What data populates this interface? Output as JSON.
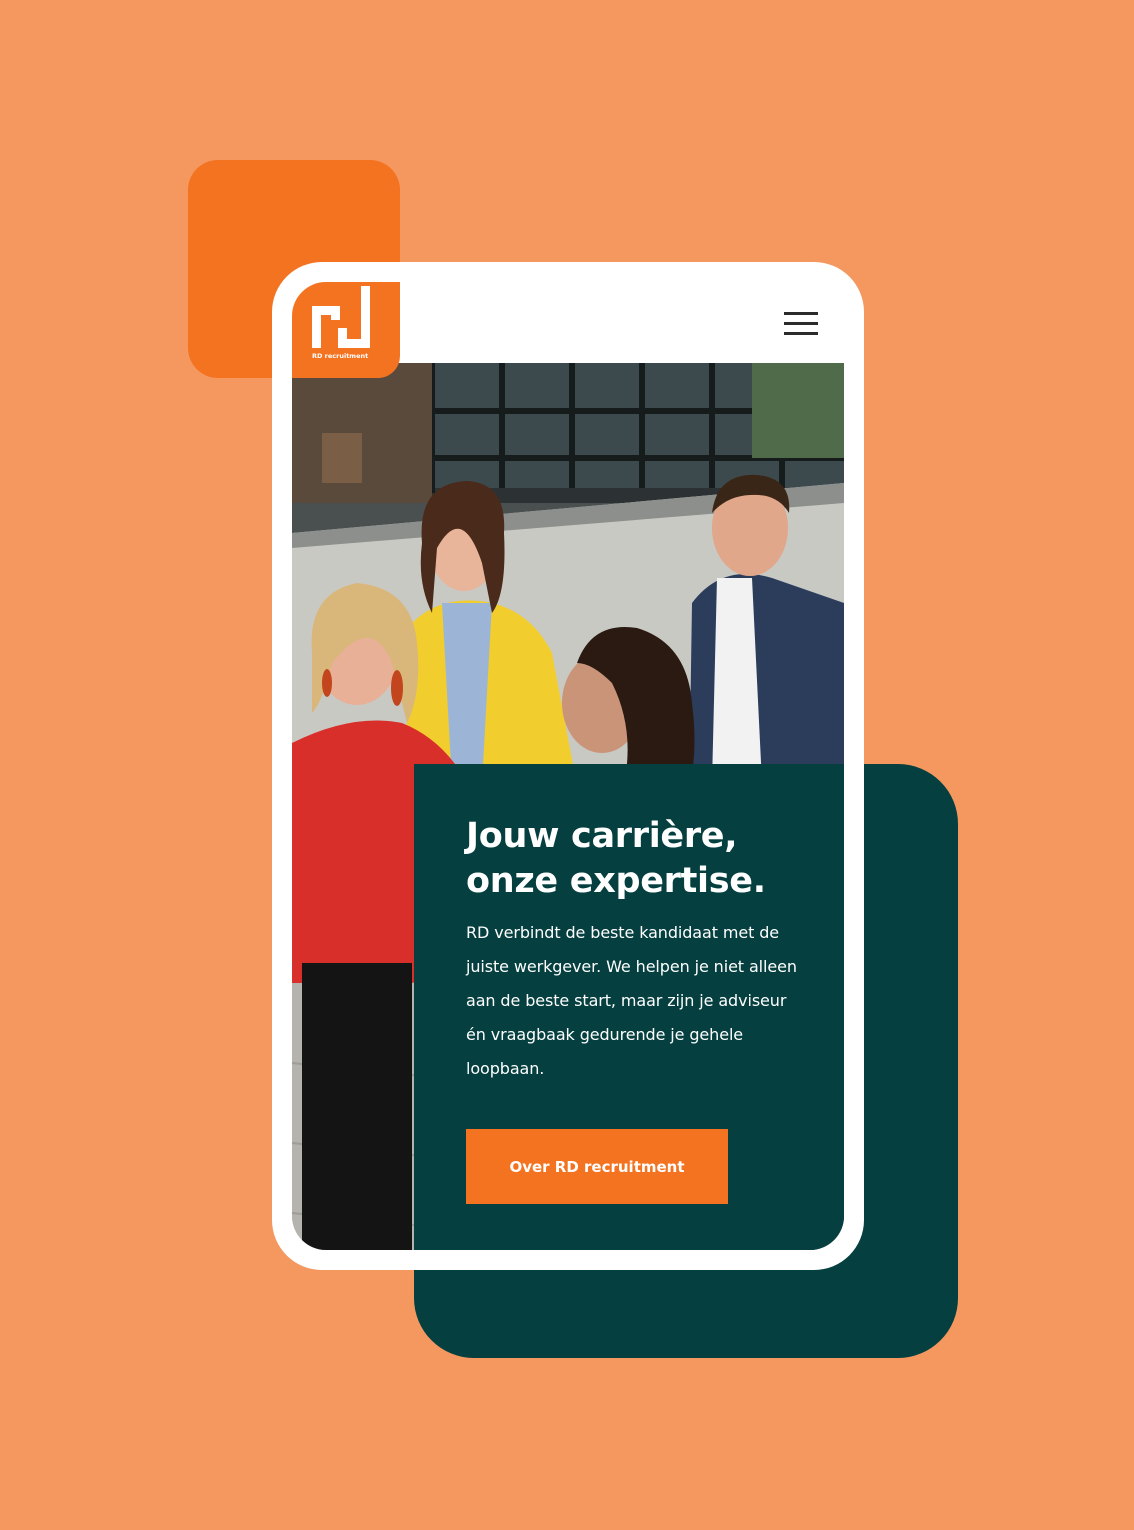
{
  "colors": {
    "background": "#f4985f",
    "brand_orange": "#f47321",
    "brand_teal": "#053f3f",
    "white": "#ffffff"
  },
  "header": {
    "logo_text": "RD recruitment",
    "logo_icon": "rd-monogram-icon",
    "menu_icon": "hamburger-menu-icon"
  },
  "hero": {
    "title": "Jouw carrière,\nonze expertise.",
    "body": "RD verbindt de beste kandidaat met de juiste werkgever. We helpen je niet alleen aan de beste start, maar zijn je adviseur én vraagbaak gedurende je gehele loopbaan.",
    "cta_label": "Over RD recruitment"
  }
}
